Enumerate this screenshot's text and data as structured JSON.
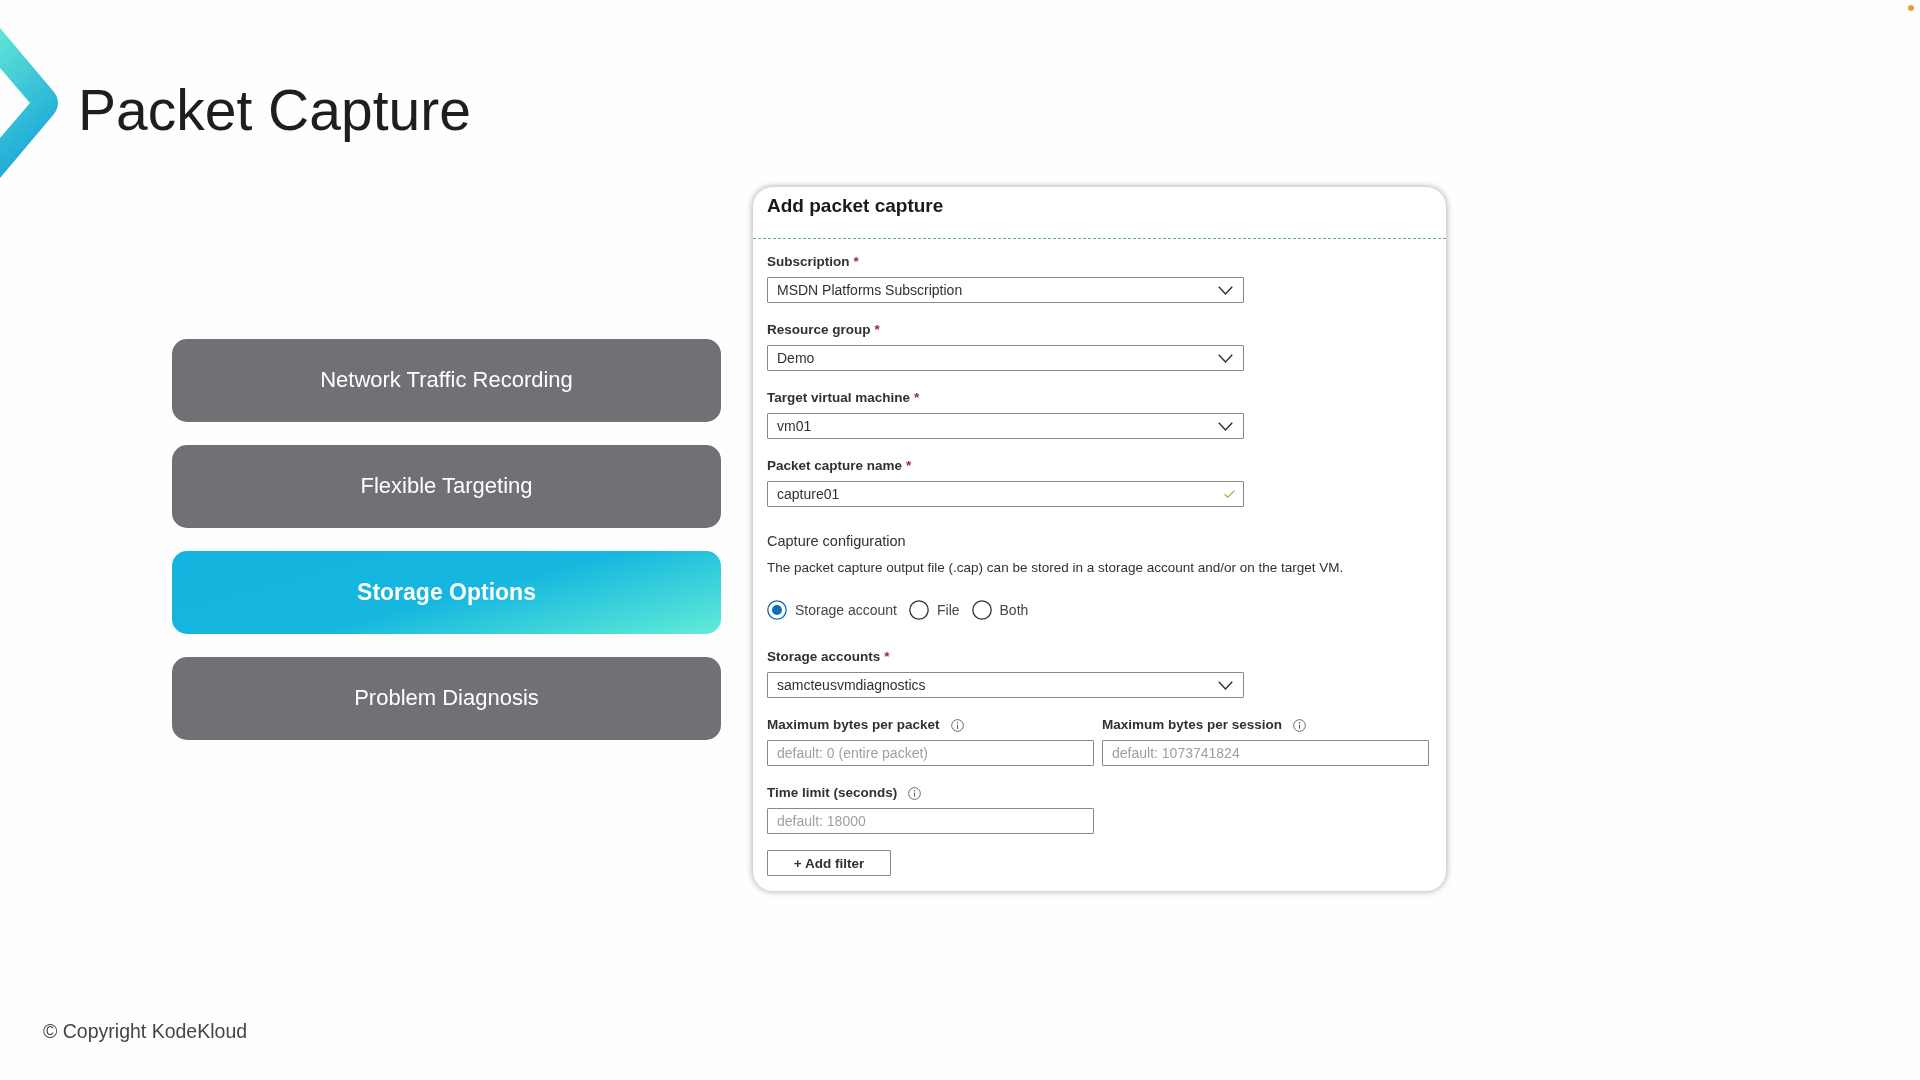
{
  "slide": {
    "title": "Packet Capture"
  },
  "topics": [
    {
      "label": "Network Traffic Recording",
      "selected": false
    },
    {
      "label": "Flexible Targeting",
      "selected": false
    },
    {
      "label": "Storage Options",
      "selected": true
    },
    {
      "label": "Problem Diagnosis",
      "selected": false
    }
  ],
  "panel": {
    "title": "Add packet capture",
    "items": [
      {
        "kind": "dropdown",
        "label": "Subscription",
        "required_mark": "*",
        "value": "MSDN Platforms Subscription"
      },
      {
        "kind": "dropdown",
        "label": "Resource group",
        "required_mark": "*",
        "value": "Demo"
      },
      {
        "kind": "dropdown",
        "label": "Target virtual machine",
        "required_mark": "*",
        "value": "vm01"
      },
      {
        "kind": "text",
        "label": "Packet capture name",
        "required_mark": "*",
        "value": "capture01",
        "valid": true
      },
      {
        "kind": "heading",
        "text": "Capture configuration"
      },
      {
        "kind": "note",
        "text": "The packet capture output file (.cap) can be stored in a storage account and/or on the target VM."
      },
      {
        "kind": "radios",
        "options": [
          {
            "label": "Storage account",
            "selected": true
          },
          {
            "label": "File",
            "selected": false
          },
          {
            "label": "Both",
            "selected": false
          }
        ]
      },
      {
        "kind": "dropdown",
        "label": "Storage accounts",
        "required_mark": "*",
        "value": "samcteusvmdiagnostics"
      },
      {
        "kind": "inputs",
        "fields": [
          {
            "label": "Maximum bytes per packet",
            "info": true,
            "placeholder": "default: 0 (entire packet)"
          },
          {
            "label": "Maximum bytes per session",
            "info": true,
            "placeholder": "default: 1073741824"
          }
        ]
      },
      {
        "kind": "inputs",
        "fields": [
          {
            "label": "Time limit (seconds)",
            "info": true,
            "placeholder": "default: 18000"
          }
        ]
      },
      {
        "kind": "button",
        "label": "+ Add filter"
      }
    ]
  },
  "footer": {
    "copyright": "© Copyright KodeKloud"
  }
}
